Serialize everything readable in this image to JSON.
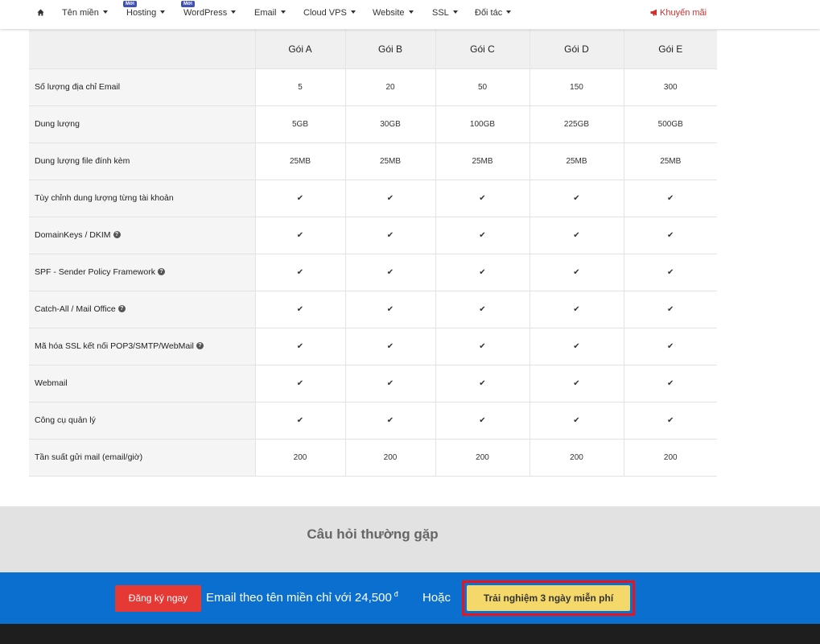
{
  "nav": {
    "home_icon": "home-icon",
    "items": [
      {
        "label": "Tên miền",
        "badge": ""
      },
      {
        "label": "Hosting",
        "badge": "Mới"
      },
      {
        "label": "WordPress",
        "badge": "Mới"
      },
      {
        "label": "Email",
        "badge": ""
      },
      {
        "label": "Cloud VPS",
        "badge": ""
      },
      {
        "label": "Website",
        "badge": ""
      },
      {
        "label": "SSL",
        "badge": ""
      },
      {
        "label": "Đối tác",
        "badge": ""
      }
    ],
    "promo": "Khuyến mãi",
    "promo_icon": "megaphone-icon"
  },
  "table": {
    "packages": [
      "Gói A",
      "Gói B",
      "Gói C",
      "Gói D",
      "Gói E"
    ],
    "rows": [
      {
        "label": "Số lượng địa chỉ Email",
        "help": false,
        "values": [
          "5",
          "20",
          "50",
          "150",
          "300"
        ]
      },
      {
        "label": "Dung lượng",
        "help": false,
        "values": [
          "5GB",
          "30GB",
          "100GB",
          "225GB",
          "500GB"
        ]
      },
      {
        "label": "Dung lượng file đính kèm",
        "help": false,
        "values": [
          "25MB",
          "25MB",
          "25MB",
          "25MB",
          "25MB"
        ]
      },
      {
        "label": "Tùy chỉnh dung lượng từng tài khoản",
        "help": false,
        "values": [
          "✔",
          "✔",
          "✔",
          "✔",
          "✔"
        ]
      },
      {
        "label": "DomainKeys / DKIM",
        "help": true,
        "values": [
          "✔",
          "✔",
          "✔",
          "✔",
          "✔"
        ]
      },
      {
        "label": "SPF - Sender Policy Framework",
        "help": true,
        "values": [
          "✔",
          "✔",
          "✔",
          "✔",
          "✔"
        ]
      },
      {
        "label": "Catch-All / Mail Office",
        "help": true,
        "values": [
          "✔",
          "✔",
          "✔",
          "✔",
          "✔"
        ]
      },
      {
        "label": "Mã hóa SSL kết nối POP3/SMTP/WebMail",
        "help": true,
        "values": [
          "✔",
          "✔",
          "✔",
          "✔",
          "✔"
        ]
      },
      {
        "label": "Webmail",
        "help": false,
        "values": [
          "✔",
          "✔",
          "✔",
          "✔",
          "✔"
        ]
      },
      {
        "label": "Công cụ quản lý",
        "help": false,
        "values": [
          "✔",
          "✔",
          "✔",
          "✔",
          "✔"
        ]
      },
      {
        "label": "Tần suất gửi mail (email/giờ)",
        "help": false,
        "values": [
          "200",
          "200",
          "200",
          "200",
          "200"
        ]
      }
    ],
    "help_glyph": "?",
    "check_color": "#1aaa73"
  },
  "faq": {
    "title": "Câu hỏi thường gặp"
  },
  "cta": {
    "register_label": "Đăng ký ngay",
    "text": "Email theo tên miền chỉ với 24,500",
    "currency": "đ",
    "or_label": "Hoặc",
    "trial_label": "Trải nghiệm 3 ngày miễn phí",
    "bar_color": "#0a6fcf",
    "highlight_color": "#e8131b"
  }
}
